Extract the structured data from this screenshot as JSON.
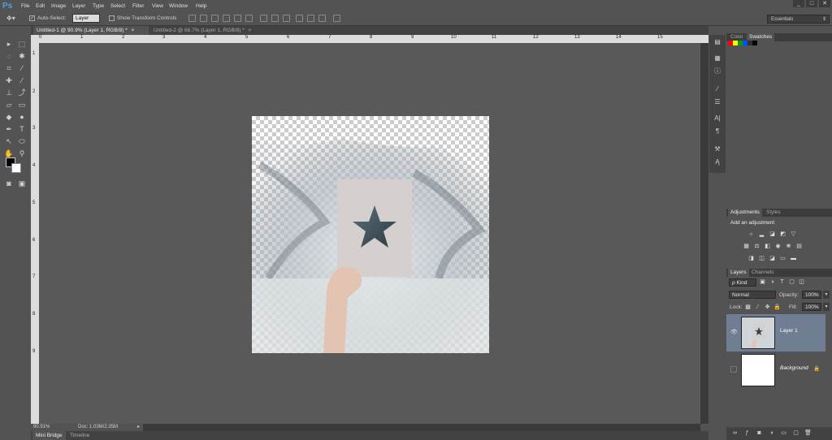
{
  "app": {
    "logo": "Ps"
  },
  "menu": [
    "File",
    "Edit",
    "Image",
    "Layer",
    "Type",
    "Select",
    "Filter",
    "View",
    "Window",
    "Help"
  ],
  "window_controls": [
    "_",
    "□",
    "✕"
  ],
  "options": {
    "auto_select_label": "Auto-Select:",
    "auto_select_value": "Layer",
    "show_transform_label": "Show Transform Controls",
    "workspace": "Essentials"
  },
  "tabs": [
    {
      "label": "Untitled-1 @ 90.9% (Layer 1, RGB/8) *",
      "close": "×"
    },
    {
      "label": "Untitled-2 @ 66.7% (Layer 1, RGB/8) *",
      "close": "×"
    }
  ],
  "rulers": {
    "top": [
      "0",
      "1",
      "2",
      "3",
      "4",
      "5",
      "6",
      "7",
      "8",
      "9",
      "10",
      "11",
      "12",
      "13",
      "14",
      "15"
    ],
    "left": [
      "1",
      "2",
      "3",
      "4",
      "5",
      "6",
      "7",
      "8",
      "9"
    ]
  },
  "status": {
    "zoom": "90.91%",
    "doc": "Doc: 1.03M/2.35M"
  },
  "bottom_tabs": [
    "Mini Bridge",
    "Timeline"
  ],
  "panels": {
    "color_tabs": [
      "Color",
      "Swatches"
    ],
    "adjust_tabs": [
      "Adjustments",
      "Styles"
    ],
    "add_adjustment": "Add an adjustment",
    "layers_tabs": [
      "Layers",
      "Channels"
    ],
    "kind": "ρ Kind",
    "blend_mode": "Normal",
    "opacity_label": "Opacity:",
    "opacity_value": "100%",
    "lock_label": "Lock:",
    "fill_label": "Fill:",
    "fill_value": "100%",
    "layers": [
      {
        "name": "Layer 1"
      },
      {
        "name": "Background"
      }
    ]
  },
  "colors": {
    "swatches": [
      "#ff0000",
      "#ffff00",
      "#00a000",
      "#0050ff",
      "#303030",
      "#000000"
    ]
  }
}
